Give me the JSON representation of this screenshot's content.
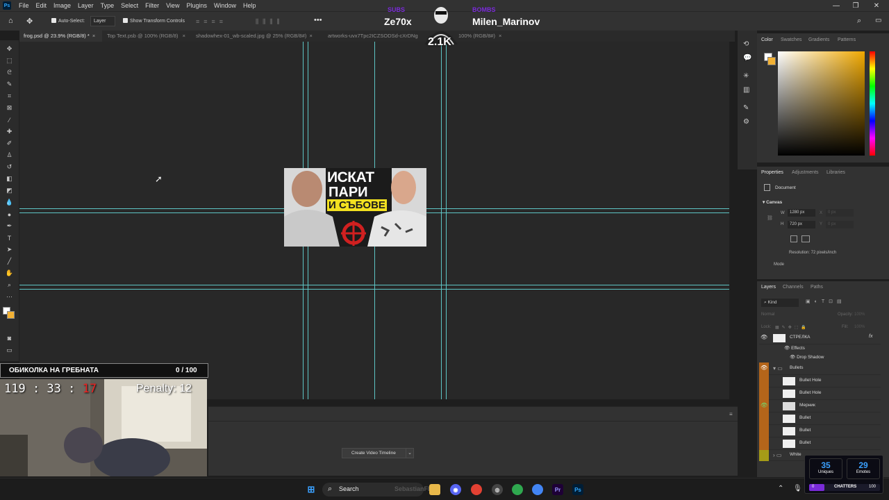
{
  "menubar": {
    "items": [
      "File",
      "Edit",
      "Image",
      "Layer",
      "Type",
      "Select",
      "Filter",
      "View",
      "Plugins",
      "Window",
      "Help"
    ]
  },
  "options_bar": {
    "auto_select": "Auto-Select:",
    "layer_select": "Layer",
    "show_transform": "Show Transform Controls"
  },
  "tabs": [
    "frog.psd @ 23.9% (RGB/8) *",
    "Top Text.psb @ 100% (RGB/8)",
    "shadowhex-01_wb-scaled.jpg @ 25% (RGB/8#)",
    "artworks-uvx7Tpc2ICZSODSd-cXrDNg",
    "100% (RGB/8#)"
  ],
  "stream_overlay": {
    "left_tag": "SUBS",
    "left_name": "Ze70x",
    "right_tag": "BOMBS",
    "right_name": "Milen_Marinov",
    "badge": "2.1K",
    "counter_label": "ОБИКОЛКА НА ГРЕБНАТА",
    "counter_value": "0 / 100",
    "timer_main": "119 : 33 :",
    "timer_seconds": "17",
    "penalty": "Penalty: 12"
  },
  "document": {
    "line1": "ИСКАТ",
    "line2": "ПАРИ",
    "line3": "И СЪБОВЕ"
  },
  "color_panel": {
    "tabs": [
      "Color",
      "Swatches",
      "Gradients",
      "Patterns"
    ],
    "active": "Color"
  },
  "properties_panel": {
    "tabs": [
      "Properties",
      "Adjustments",
      "Libraries"
    ],
    "document_label": "Document",
    "canvas_label": "Canvas",
    "w_label": "W",
    "w_value": "1280 px",
    "h_label": "H",
    "h_value": "720 px",
    "x_label": "X",
    "x_placeholder": "0 px",
    "y_label": "Y",
    "y_placeholder": "0 px",
    "resolution": "Resolution: 72 pixels/inch",
    "mode": "Mode"
  },
  "layers_panel": {
    "tabs": [
      "Layers",
      "Channels",
      "Paths"
    ],
    "kind": "Kind",
    "blend": "Normal",
    "opacity": "Opacity:",
    "opacity_value": "100%",
    "lock": "Lock:",
    "fill": "Fill:",
    "fill_value": "100%",
    "layers": [
      {
        "name": "СТРЕЛКА",
        "fx": "fx"
      },
      {
        "name": "Effects"
      },
      {
        "name": "Drop Shadow"
      },
      {
        "name": "Bullets"
      },
      {
        "name": "Bullet Hole"
      },
      {
        "name": "Bullet Hole"
      },
      {
        "name": "Мерник"
      },
      {
        "name": "Bullet"
      },
      {
        "name": "Bullet"
      },
      {
        "name": "Bullet"
      },
      {
        "name": "White"
      }
    ]
  },
  "timeline": {
    "create_button": "Create Video Timeline"
  },
  "taskbar": {
    "search": "Search",
    "ghost_text": "SebastianFPS"
  },
  "chatters": {
    "uniques_value": "35",
    "uniques_label": "Uniques",
    "emotes_value": "29",
    "emotes_label": "Emotes",
    "bar_left": "0",
    "bar_label": "CHATTERS",
    "bar_right": "100"
  },
  "colors": {
    "guide": "#5ec6c6",
    "accent_purple": "#7a2bd8",
    "chatters_blue": "#3aa0ff"
  }
}
